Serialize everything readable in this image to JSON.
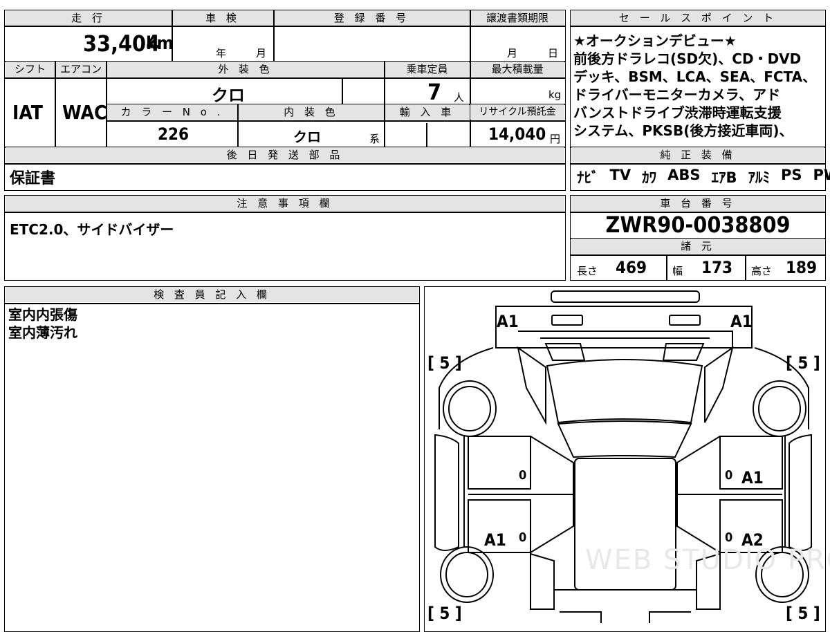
{
  "info": {
    "mileage_label": "走 行",
    "mileage_value": "33,404",
    "mileage_unit": "km",
    "shaken_label": "車 検",
    "shaken_year": "年",
    "shaken_month": "月",
    "reg_no_label": "登 録 番 号",
    "transfer_label": "譲渡書類期限",
    "transfer_month": "月",
    "transfer_day": "日",
    "shift_label": "シフト",
    "shift_value": "IAT",
    "ac_label": "エアコン",
    "ac_value": "WAC",
    "ext_color_label": "外 装 色",
    "ext_color_value": "クロ",
    "capacity_label": "乗車定員",
    "capacity_value": "7",
    "capacity_unit": "人",
    "max_load_label": "最大積載量",
    "max_load_unit": "kg",
    "color_no_label": "カ ラ ー N o .",
    "color_no_value": "226",
    "int_color_label": "内 装 色",
    "int_color_value": "クロ",
    "int_color_suffix": "系",
    "import_label": "輸 入 車",
    "recycle_label": "リサイクル預託金",
    "recycle_value": "14,040",
    "recycle_unit": "円",
    "later_parts_label": "後 日 発 送 部 品",
    "later_parts_value": "保証書"
  },
  "sales_points": {
    "label": "セ ー ル ス ポ イ ン ト",
    "lines": [
      "★オークションデビュー★",
      "前後方ドラレコ(SD欠)、CD・DVD",
      "デッキ、BSM、LCA、SEA、FCTA、",
      "ドライバーモニターカメラ、アド",
      "バンストドライブ渋滞時運転支援",
      "システム、PKSB(後方接近車両)、"
    ]
  },
  "equipment": {
    "label": "純 正 装 備",
    "items": [
      "ﾅﾋﾞ",
      "TV",
      "ｶﾜ",
      "ABS",
      "ｴｱB",
      "ｱﾙﾐ",
      "PS",
      "PW"
    ]
  },
  "notes": {
    "label": "注 意 事 項 欄",
    "text": "ETC2.0、サイドバイザー"
  },
  "chassis": {
    "label": "車 台 番 号",
    "value": "ZWR90-0038809",
    "spec_label": "諸 元",
    "length_label": "長さ",
    "length_value": "469",
    "width_label": "幅",
    "width_value": "173",
    "height_label": "高さ",
    "height_value": "189"
  },
  "inspector": {
    "label": "検 査 員 記 入 欄",
    "lines": [
      "室内内張傷",
      "室内薄汚れ"
    ]
  },
  "diagram": {
    "marks": {
      "a1_front_left": "A1",
      "a1_front_right": "A1",
      "tire_fl": "[ 5 ]",
      "tire_fr": "[ 5 ]",
      "tire_rl": "[ 5 ]",
      "tire_rr": "[ 5 ]",
      "a1_right_front_door": "A1",
      "a1_left_rear_door": "A1",
      "a2_right_rear_door": "A2",
      "handle_lf": "0",
      "handle_rf": "0",
      "handle_lr": "0",
      "handle_rr": "0"
    },
    "watermark": "WEB STUDIO PRO"
  }
}
